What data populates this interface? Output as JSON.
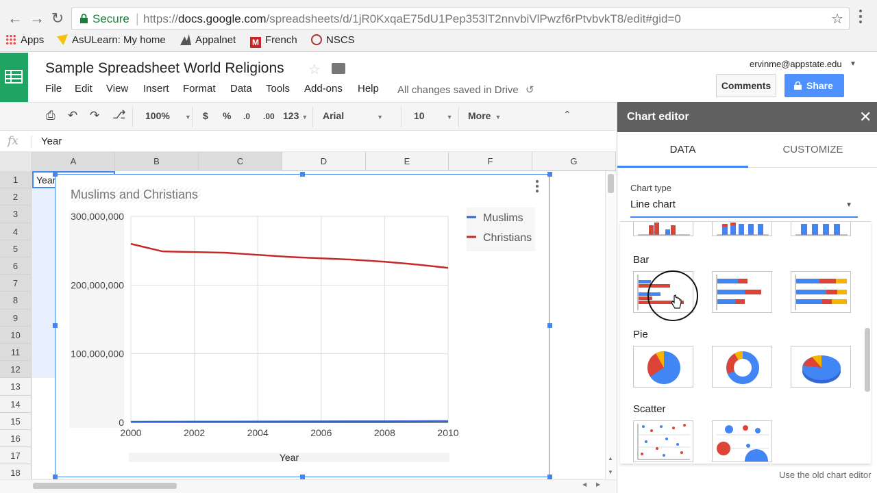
{
  "browser": {
    "secure_label": "Secure",
    "url_prefix": "https://",
    "url_host": "docs.google.com",
    "url_path": "/spreadsheets/d/1jR0KxqaE75dU1Pep353lT2nnvbiVlPwzf6rPtvbvkT8/edit#gid=0",
    "bookmarks": [
      {
        "label": "Apps",
        "icon": "apps-grid-icon"
      },
      {
        "label": "AsULearn: My home",
        "icon": "asulearn-icon"
      },
      {
        "label": "Appalnet",
        "icon": "appalnet-icon"
      },
      {
        "label": "French",
        "icon": "french-m-icon"
      },
      {
        "label": "NSCS",
        "icon": "nscs-icon"
      }
    ]
  },
  "sheet": {
    "title": "Sample Spreadsheet World Religions",
    "menus": [
      "File",
      "Edit",
      "View",
      "Insert",
      "Format",
      "Data",
      "Tools",
      "Add-ons",
      "Help"
    ],
    "saved_status": "All changes saved in Drive",
    "account_email": "ervinme@appstate.edu",
    "comments_label": "Comments",
    "share_label": "Share"
  },
  "toolbar": {
    "zoom": "100%",
    "currency": "$",
    "percent": "%",
    "decrease_decimals": ".0",
    "increase_decimals": ".00",
    "more_formats": "123",
    "font": "Arial",
    "font_size": "10",
    "more": "More"
  },
  "formula_bar": {
    "fx": "fx",
    "value": "Year"
  },
  "grid": {
    "columns": [
      "A",
      "B",
      "C",
      "D",
      "E",
      "F",
      "G"
    ],
    "rows": [
      "1",
      "2",
      "3",
      "4",
      "5",
      "6",
      "7",
      "8",
      "9",
      "10",
      "11",
      "12",
      "13",
      "14",
      "15",
      "16",
      "17",
      "18"
    ],
    "cell_a1": "Year"
  },
  "chart_data": {
    "type": "line",
    "title": "Muslims and Christians",
    "xlabel": "Year",
    "ylabel": "",
    "x": [
      2000,
      2001,
      2002,
      2003,
      2004,
      2005,
      2006,
      2007,
      2008,
      2009,
      2010
    ],
    "xticks": [
      "2000",
      "2002",
      "2004",
      "2006",
      "2008",
      "2010"
    ],
    "yticks": [
      "0",
      "100,000,000",
      "200,000,000",
      "300,000,000"
    ],
    "xlim": [
      2000,
      2010
    ],
    "ylim": [
      0,
      300000000
    ],
    "grid": true,
    "legend_position": "right",
    "series": [
      {
        "name": "Muslims",
        "color": "#3366cc",
        "values": [
          1000000,
          1100000,
          1200000,
          1300000,
          1400000,
          1500000,
          1600000,
          1700000,
          1800000,
          1900000,
          2000000
        ]
      },
      {
        "name": "Christians",
        "color": "#c62828",
        "values": [
          260000000,
          249000000,
          248000000,
          247000000,
          244000000,
          241000000,
          239000000,
          237000000,
          234000000,
          230000000,
          225000000
        ]
      }
    ]
  },
  "editor": {
    "title": "Chart editor",
    "tabs": [
      "DATA",
      "CUSTOMIZE"
    ],
    "chart_type_label": "Chart type",
    "chart_type_value": "Line chart",
    "sections": {
      "bar": "Bar",
      "pie": "Pie",
      "scatter": "Scatter"
    },
    "old_editor_link": "Use the old chart editor"
  },
  "colors": {
    "accent": "#4285f4",
    "sheets_green": "#1fa463",
    "share": "#4d90fe",
    "red": "#db4437",
    "yellow": "#f4b400"
  }
}
